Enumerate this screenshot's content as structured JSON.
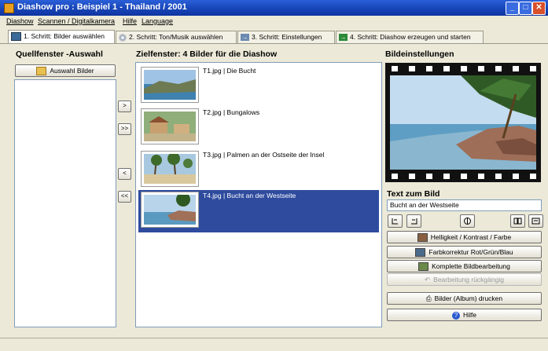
{
  "window": {
    "title": "Diashow pro : Beispiel 1 - Thailand / 2001"
  },
  "menu": [
    "Diashow",
    "Scannen / Digitalkamera",
    "Hilfe",
    "Language"
  ],
  "tabs": [
    {
      "label": "1. Schritt: Bilder auswählen",
      "icon": "monitor-icon",
      "active": true
    },
    {
      "label": "2. Schritt: Ton/Musik auswählen",
      "icon": "cd-icon",
      "active": false
    },
    {
      "label": "3. Schritt: Einstellungen",
      "icon": "arrow-right-icon",
      "active": false
    },
    {
      "label": "4. Schritt: Diashow erzeugen und starten",
      "icon": "arrow-right-green-icon",
      "active": false
    }
  ],
  "source": {
    "title": "Quellfenster -Auswahl",
    "select_button": "Auswahl Bilder"
  },
  "target": {
    "title": "Zielfenster: 4 Bilder für die Diashow",
    "items": [
      {
        "caption": "T1.jpg | Die Bucht",
        "selected": false
      },
      {
        "caption": "T2.jpg | Bungalows",
        "selected": false
      },
      {
        "caption": "T3.jpg | Palmen an der Ostseite der Insel",
        "selected": false
      },
      {
        "caption": "T4.jpg | Bucht an der Westseite",
        "selected": true
      }
    ]
  },
  "transfer_buttons": [
    ">",
    ">>",
    "<",
    "<<"
  ],
  "settings": {
    "title": "Bildeinstellungen",
    "text_label": "Text zum Bild",
    "text_value": "Bucht an der Westseite",
    "buttons": [
      {
        "label": "Helligkeit / Kontrast / Farbe",
        "enabled": true
      },
      {
        "label": "Farbkorrektur Rot/Grün/Blau",
        "enabled": true
      },
      {
        "label": "Komplette Bildbearbeitung",
        "enabled": true
      },
      {
        "label": "Bearbeitung rückgängig",
        "enabled": false
      },
      {
        "label": "Bilder (Album) drucken",
        "enabled": true
      },
      {
        "label": "Hilfe",
        "enabled": true
      }
    ]
  },
  "colors": {
    "titlebar": "#1845B8",
    "selection": "#2E4B9E",
    "background": "#ECE9D8"
  }
}
